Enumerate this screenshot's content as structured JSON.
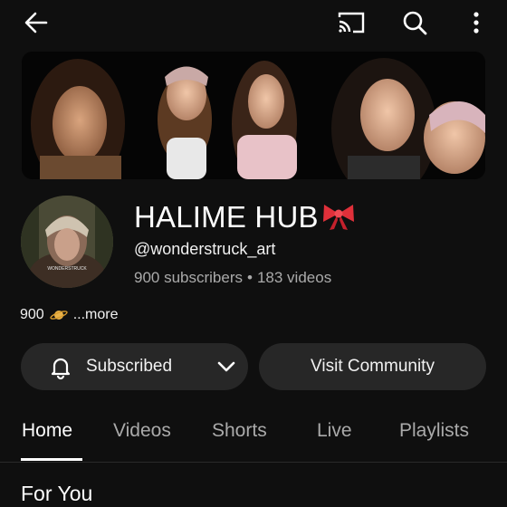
{
  "topbar": {
    "icons": [
      "arrow-left-icon",
      "cast-icon",
      "search-icon",
      "more-vert-icon"
    ]
  },
  "channel": {
    "name": "HALIME HUB",
    "name_emoji": "ribbon-bow-icon",
    "handle": "@wonderstruck_art",
    "subscribers": "900 subscribers",
    "separator": "•",
    "videos": "183 videos",
    "avatar_watermark": "WONDERSTRUCK"
  },
  "description": {
    "prefix": "900",
    "emoji": "ringed-planet-icon",
    "more": "...more"
  },
  "actions": {
    "subscribed_label": "Subscribed",
    "community_label": "Visit Community"
  },
  "tabs": [
    {
      "label": "Home",
      "active": true
    },
    {
      "label": "Videos",
      "active": false
    },
    {
      "label": "Shorts",
      "active": false
    },
    {
      "label": "Live",
      "active": false
    },
    {
      "label": "Playlists",
      "active": false
    }
  ],
  "section": {
    "title": "For You"
  },
  "colors": {
    "background": "#0f0f0f",
    "pill": "#272727",
    "secondary_text": "#aaaaaa",
    "bow_red": "#e0303a"
  }
}
